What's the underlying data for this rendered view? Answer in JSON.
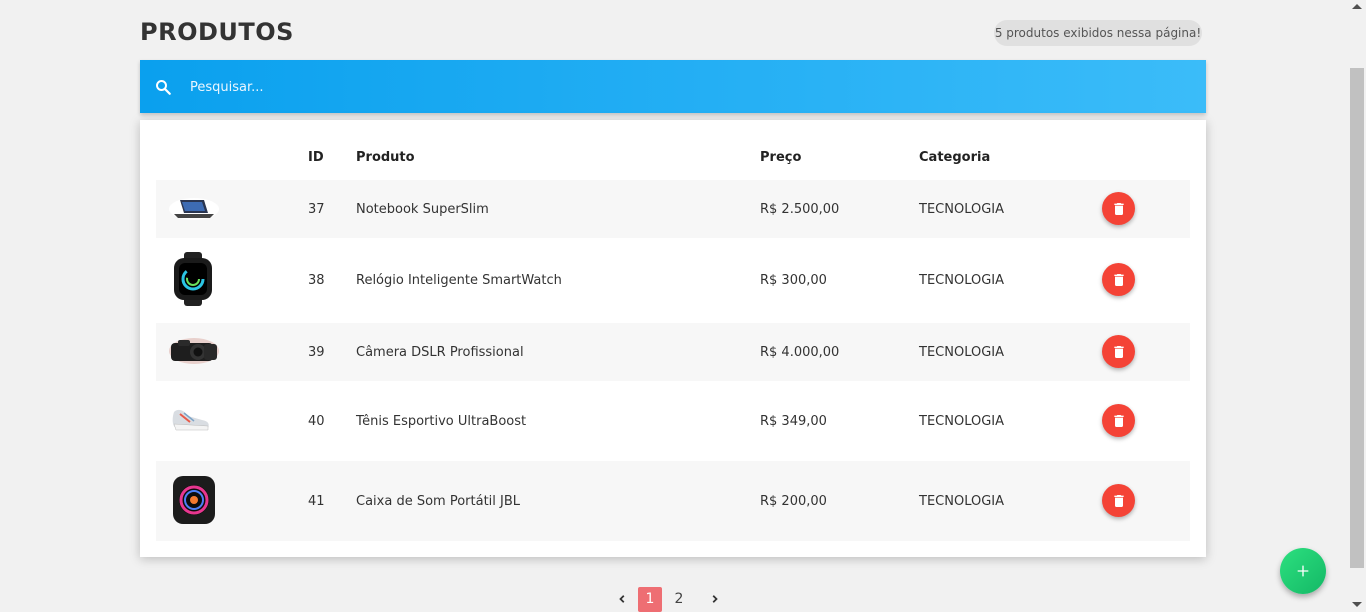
{
  "header": {
    "title": "PRODUTOS",
    "count_badge": "5 produtos exibidos nessa página!"
  },
  "search": {
    "placeholder": "Pesquisar...",
    "icon": "search-icon"
  },
  "table": {
    "columns": [
      "",
      "ID",
      "Produto",
      "Preço",
      "Categoria",
      ""
    ],
    "rows": [
      {
        "id": "37",
        "name": "Notebook SuperSlim",
        "price": "R$ 2.500,00",
        "category": "TECNOLOGIA",
        "image": "laptop-image"
      },
      {
        "id": "38",
        "name": "Relógio Inteligente SmartWatch",
        "price": "R$ 300,00",
        "category": "TECNOLOGIA",
        "image": "smartwatch-image"
      },
      {
        "id": "39",
        "name": "Câmera DSLR Profissional",
        "price": "R$ 4.000,00",
        "category": "TECNOLOGIA",
        "image": "camera-image"
      },
      {
        "id": "40",
        "name": "Tênis Esportivo UltraBoost",
        "price": "R$ 349,00",
        "category": "TECNOLOGIA",
        "image": "sneaker-image"
      },
      {
        "id": "41",
        "name": "Caixa de Som Portátil JBL",
        "price": "R$ 200,00",
        "category": "TECNOLOGIA",
        "image": "speaker-image"
      }
    ],
    "delete_icon": "trash-icon"
  },
  "pagination": {
    "pages": [
      "1",
      "2"
    ],
    "current": "1",
    "prev_icon": "chevron-left-icon",
    "next_icon": "chevron-right-icon"
  },
  "fab": {
    "icon": "plus-icon"
  },
  "colors": {
    "search_gradient_start": "#0aa0ee",
    "search_gradient_end": "#3bbcf9",
    "delete_red": "#f44336",
    "active_page": "#ee6e73",
    "fab_green": "#1ec872",
    "page_bg": "#f1f1f1"
  }
}
